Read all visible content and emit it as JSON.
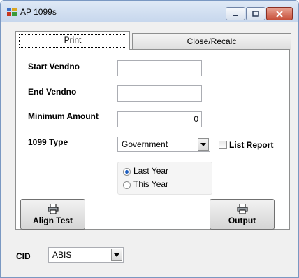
{
  "window": {
    "title": "AP 1099s"
  },
  "tabs": [
    {
      "label": "Print"
    },
    {
      "label": "Close/Recalc"
    }
  ],
  "form": {
    "start_vendno_label": "Start Vendno",
    "start_vendno_value": "",
    "end_vendno_label": "End Vendno",
    "end_vendno_value": "",
    "minimum_amount_label": "Minimum Amount",
    "minimum_amount_value": "0",
    "type_label": "1099 Type",
    "type_value": "Government",
    "list_report_label": "List Report",
    "list_report_checked": false,
    "year_options": [
      {
        "label": "Last Year",
        "selected": true
      },
      {
        "label": "This Year",
        "selected": false
      }
    ]
  },
  "buttons": {
    "align_test": "Align Test",
    "output": "Output"
  },
  "cid": {
    "label": "CID",
    "value": "ABIS"
  }
}
